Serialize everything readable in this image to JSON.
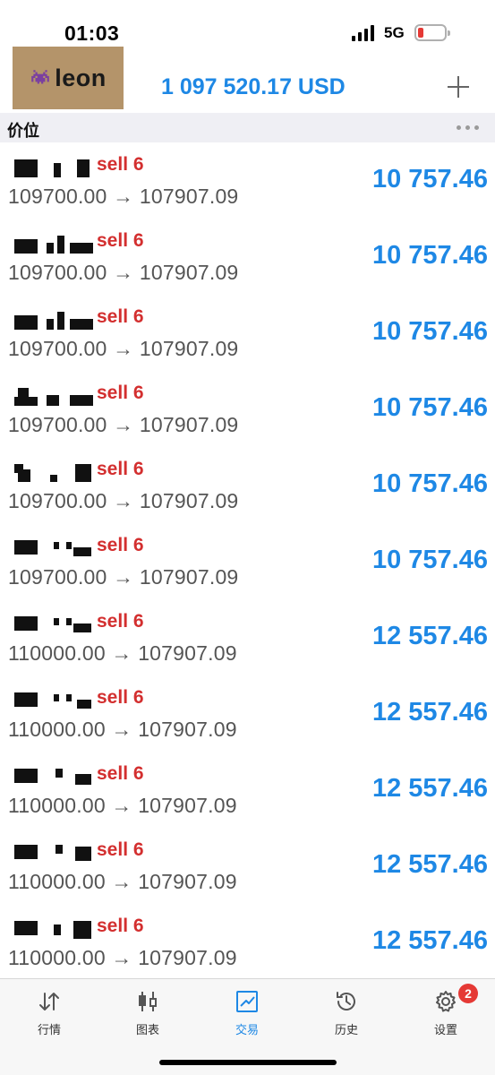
{
  "status_bar": {
    "time": "01:03",
    "network": "5G",
    "battery_color": "#e53935"
  },
  "header": {
    "logo_text": "leon",
    "balance": "1 097 520.17 USD",
    "add_icon": "plus-icon"
  },
  "section": {
    "title": "价位",
    "more_icon": "more-dots-icon"
  },
  "orders": [
    {
      "side": "sell 6",
      "prices": "109700.00 → 107907.09",
      "profit": "10 757.46"
    },
    {
      "side": "sell 6",
      "prices": "109700.00 → 107907.09",
      "profit": "10 757.46"
    },
    {
      "side": "sell 6",
      "prices": "109700.00 → 107907.09",
      "profit": "10 757.46"
    },
    {
      "side": "sell 6",
      "prices": "109700.00 → 107907.09",
      "profit": "10 757.46"
    },
    {
      "side": "sell 6",
      "prices": "109700.00 → 107907.09",
      "profit": "10 757.46"
    },
    {
      "side": "sell 6",
      "prices": "109700.00 → 107907.09",
      "profit": "10 757.46"
    },
    {
      "side": "sell 6",
      "prices": "110000.00 → 107907.09",
      "profit": "12 557.46"
    },
    {
      "side": "sell 6",
      "prices": "110000.00 → 107907.09",
      "profit": "12 557.46"
    },
    {
      "side": "sell 6",
      "prices": "110000.00 → 107907.09",
      "profit": "12 557.46"
    },
    {
      "side": "sell 6",
      "prices": "110000.00 → 107907.09",
      "profit": "12 557.46"
    },
    {
      "side": "sell 6",
      "prices": "110000.00 → 107907.09",
      "profit": "12 557.46"
    }
  ],
  "tabs": [
    {
      "label": "行情",
      "icon": "quotes-arrows-icon"
    },
    {
      "label": "图表",
      "icon": "candlestick-chart-icon"
    },
    {
      "label": "交易",
      "icon": "trade-chart-icon",
      "active": true
    },
    {
      "label": "历史",
      "icon": "history-clock-icon"
    },
    {
      "label": "设置",
      "icon": "settings-gear-icon",
      "badge": "2"
    }
  ],
  "colors": {
    "accent": "#1e88e5",
    "sell": "#d32f2f",
    "logo_bg": "#b4946a"
  }
}
